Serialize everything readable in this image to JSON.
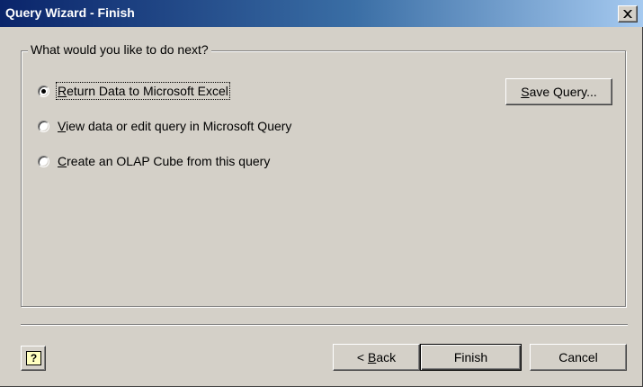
{
  "window": {
    "title": "Query Wizard - Finish"
  },
  "group": {
    "legend": "What would you like to do next?"
  },
  "options": [
    {
      "key": "R",
      "rest": "eturn Data to Microsoft Excel",
      "checked": true
    },
    {
      "key": "V",
      "rest": "iew data or edit query in Microsoft Query",
      "checked": false
    },
    {
      "key": "C",
      "rest": "reate an OLAP Cube from this query",
      "checked": false
    }
  ],
  "buttons": {
    "save_query": {
      "key": "S",
      "rest": "ave Query..."
    },
    "back": {
      "prefix": "< ",
      "key": "B",
      "rest": "ack"
    },
    "finish": "Finish",
    "cancel": "Cancel"
  },
  "help": {
    "glyph": "?"
  }
}
